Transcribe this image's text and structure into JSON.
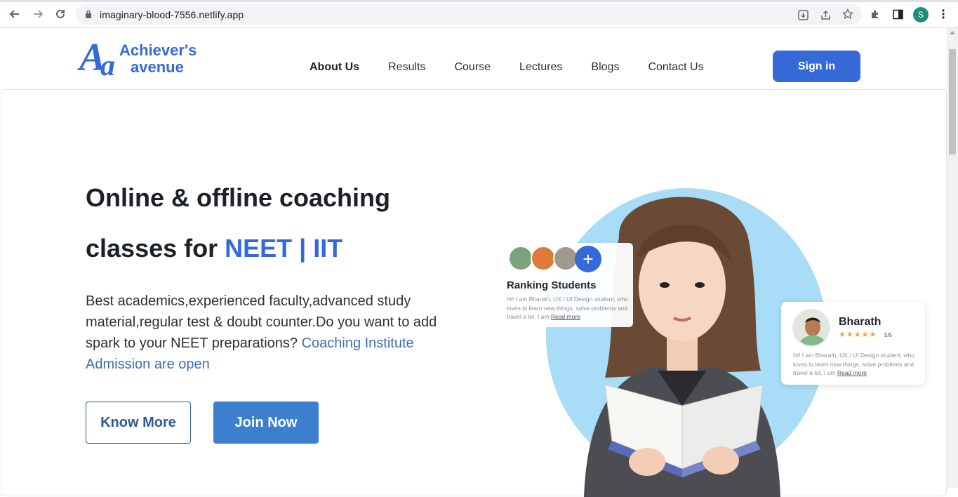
{
  "browser": {
    "url": "imaginary-blood-7556.netlify.app",
    "profile_initial": "S",
    "icons": [
      "back-icon",
      "forward-icon",
      "reload-icon",
      "lock-icon",
      "install-icon",
      "share-icon",
      "star-icon",
      "extensions-icon",
      "side-panel-icon",
      "menu-icon"
    ]
  },
  "header": {
    "logo": {
      "mark_big": "A",
      "mark_small": "a",
      "line1": "Achiever's",
      "line2": "avenue"
    },
    "nav": [
      "About Us",
      "Results",
      "Course",
      "Lectures",
      "Blogs",
      "Contact Us"
    ],
    "active_nav": "About Us",
    "signin_label": "Sign in"
  },
  "hero": {
    "headline_line1": "Online & offline coaching",
    "headline_line2_prefix": "classes for ",
    "headline_line2_accent": "NEET | IIT",
    "description": "Best academics,experienced faculty,advanced study material,regular test & doubt counter.Do you want to add spark to your NEET preparations? ",
    "description_link": "Coaching Institute Admission are open",
    "know_more_label": "Know More",
    "join_now_label": "Join Now"
  },
  "ranking_card": {
    "plus": "+",
    "title": "Ranking Students",
    "text": "Hi! I am Bharath, UX / UI Design student, who loves to learn new things, solve problems and travel a lot.  I am ",
    "read_more": "Read more"
  },
  "profile_card": {
    "name": "Bharath",
    "stars": "★★★★★",
    "rating": "5/5",
    "text": "Hi! I am Bharath, UX / UI Design student, who loves to learn new things, solve problems and travel a lot.  I am ",
    "read_more": "Read more"
  },
  "colors": {
    "brand": "#3569d8",
    "join_button": "#3c7fcf",
    "circle": "#a9dcf7",
    "link": "#3e6fb5"
  }
}
